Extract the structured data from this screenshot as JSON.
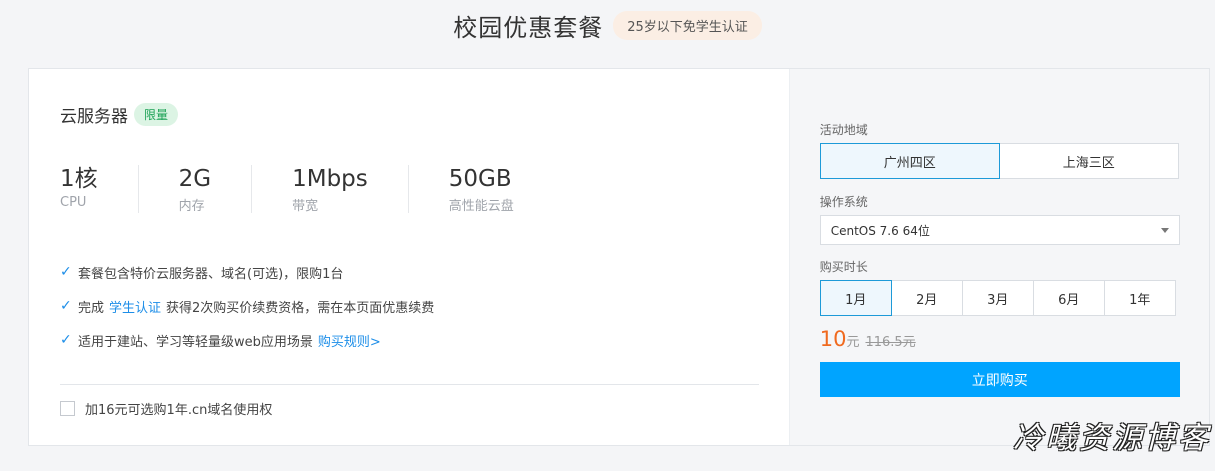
{
  "header": {
    "title": "校园优惠套餐",
    "badge": "25岁以下免学生认证"
  },
  "product": {
    "name": "云服务器",
    "badge": "限量",
    "specs": [
      {
        "value": "1核",
        "label": "CPU"
      },
      {
        "value": "2G",
        "label": "内存"
      },
      {
        "value": "1Mbps",
        "label": "带宽"
      },
      {
        "value": "50GB",
        "label": "高性能云盘"
      }
    ],
    "features": [
      {
        "before": "套餐包含特价云服务器、域名(可选)，限购1台"
      },
      {
        "before": "完成",
        "link": "学生认证",
        "after": "获得2次购买价续费资格，需在本页面优惠续费"
      },
      {
        "before": "适用于建站、学习等轻量级web应用场景",
        "link": "购买规则>"
      }
    ],
    "domain_option": "加16元可选购1年.cn域名使用权"
  },
  "purchase": {
    "region_label": "活动地域",
    "regions": [
      "广州四区",
      "上海三区"
    ],
    "os_label": "操作系统",
    "os_value": "CentOS 7.6 64位",
    "duration_label": "购买时长",
    "durations": [
      "1月",
      "2月",
      "3月",
      "6月",
      "1年"
    ],
    "price": "10",
    "price_unit": "元",
    "original_price": "116.5元",
    "buy_label": "立即购买"
  },
  "watermark": "冷曦资源博客",
  "colors": {
    "accent": "#00a4ff",
    "price": "#f06a1f",
    "badge_green": "#1aa154"
  }
}
